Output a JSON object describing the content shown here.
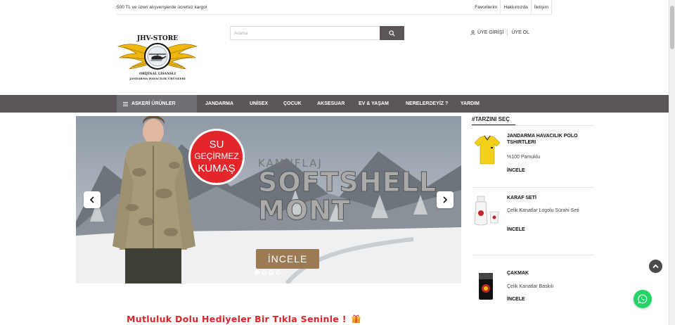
{
  "topbar": {
    "promo": "500 TL ve üzeri alışverişlerde ücretsiz kargo!",
    "links": [
      "Favorilerim",
      "Hakkımızda",
      "İletişim"
    ]
  },
  "logo": {
    "brand": "JHV-STORE",
    "line1": "ORİJİNAL LİSANSLI",
    "line2": "JANDARMA HAVACILIK ÜRÜNLERİ"
  },
  "search": {
    "placeholder": "Arama",
    "icon": "search-icon"
  },
  "account": {
    "login": "ÜYE GİRİŞİ",
    "register": "ÜYE OL"
  },
  "nav": {
    "items": [
      "ASKERİ ÜRÜNLER",
      "JANDARMA",
      "UNİSEX",
      "ÇOCUK",
      "AKSESUAR",
      "EV & YAŞAM",
      "NERELERDEYİZ ?",
      "YARDIM"
    ]
  },
  "slider": {
    "badge": [
      "SU",
      "GEÇİRMEZ",
      "KUMAŞ"
    ],
    "title1": "KAMUFLAJ",
    "title2a": "SOFTSHELL",
    "title2b": "MONT",
    "cta": "İNCELE",
    "slide_count": 4,
    "active_slide": 1
  },
  "side": {
    "heading": "#TARZINI SEÇ",
    "products": [
      {
        "name": "JANDARMA HAVACILIK POLO TSHIRTLERI",
        "desc": "%100 Pamuklu",
        "more": "İNCELE"
      },
      {
        "name": "KARAF SETİ",
        "desc": "Çelik Kanatlar Logolu Sürahi Seti",
        "more": "İNCELE"
      },
      {
        "name": "ÇAKMAK",
        "desc": "Çelik Kanatlar Baskılı",
        "more": "İNCELE"
      }
    ]
  },
  "gift_text": "Mutluluk Dolu Hediyeler Bir Tıkla Seninle !",
  "colors": {
    "nav_bg": "#5b555a",
    "nav_active": "#6f7076",
    "accent_red": "#d9262b",
    "whatsapp": "#25d366"
  }
}
